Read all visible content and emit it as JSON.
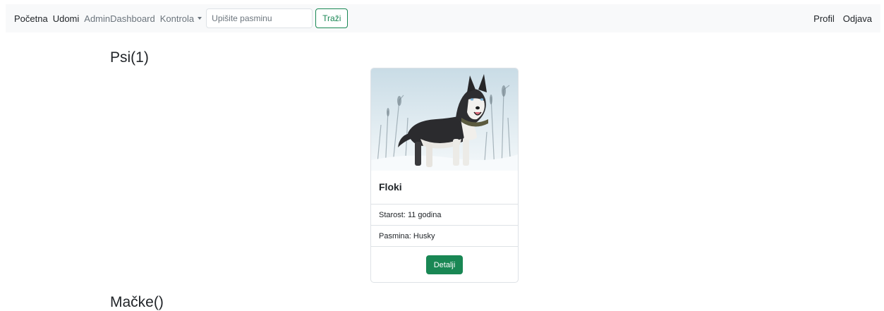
{
  "navbar": {
    "links_left": {
      "home": "Početna",
      "adopt": "Udomi",
      "admin": "AdminDashboard",
      "control": "Kontrola"
    },
    "search": {
      "placeholder": "Upišite pasminu",
      "value": ""
    },
    "search_button": "Traži",
    "links_right": {
      "profile": "Profil",
      "logout": "Odjava"
    },
    "icons": {
      "dropdown": "caret-down-icon"
    }
  },
  "sections": {
    "dogs": {
      "title": "Psi(1)",
      "cards": [
        {
          "name": "Floki",
          "age": "Starost: 11 godina",
          "breed": "Pasmina: Husky",
          "button": "Detalji",
          "image": "husky-photo"
        }
      ]
    },
    "cats": {
      "title": "Mačke()"
    }
  },
  "colors": {
    "accent": "#198754",
    "navbar_bg": "#f8f9fa",
    "border": "#dee2e6",
    "muted_text": "#6c757d"
  }
}
